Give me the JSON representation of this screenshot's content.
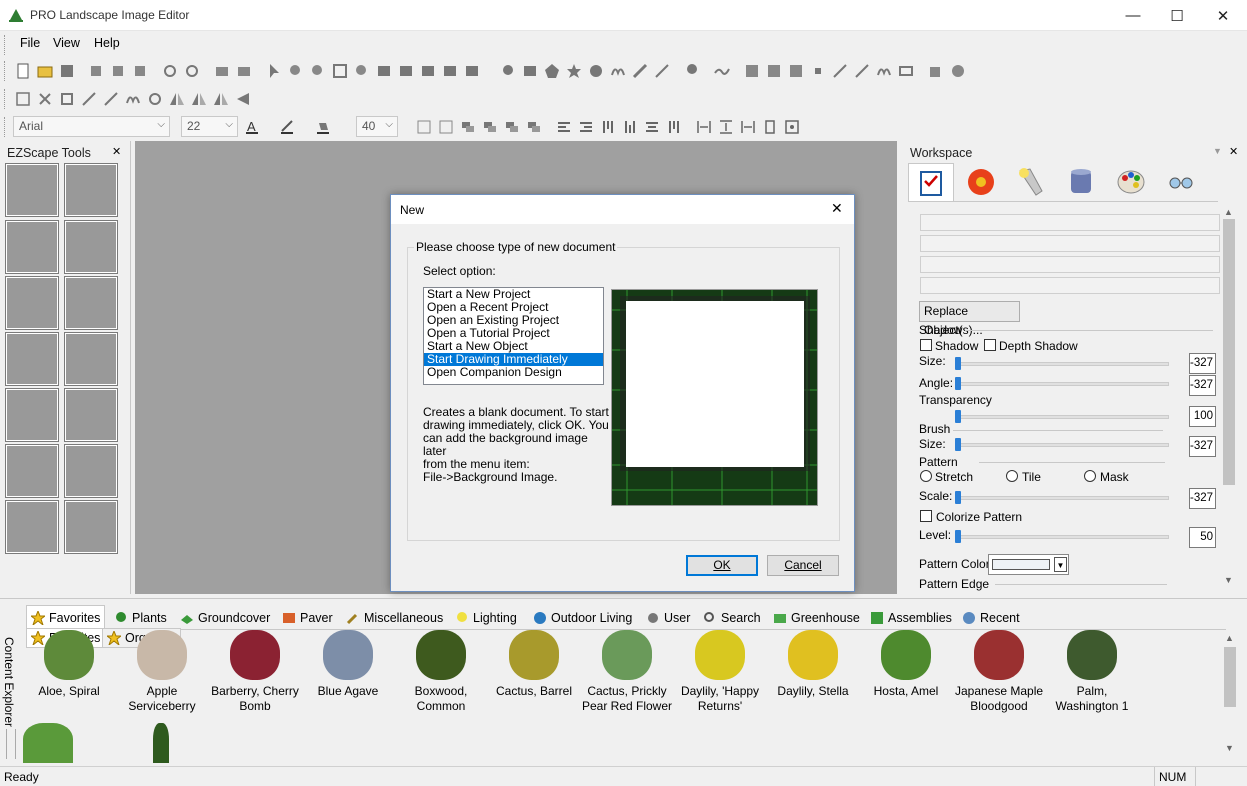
{
  "app": {
    "title": "PRO Landscape Image Editor"
  },
  "window_controls": {
    "minimize": "—",
    "maximize": "☐",
    "close": "✕"
  },
  "menu": [
    "File",
    "View",
    "Help"
  ],
  "toolbar": {
    "font_name": "Arial",
    "font_size": "22",
    "line_width": "40"
  },
  "left_panel": {
    "title": "EZScape Tools",
    "close": "✕"
  },
  "workspace": {
    "title": "Workspace",
    "close": "✕",
    "tabs": [
      "checklist-icon",
      "flower-icon",
      "flashlight-icon",
      "database-icon",
      "palette-icon",
      "glasses-icon"
    ],
    "replace_button": "Replace Object(s)...",
    "shadow_heading": "Shadow",
    "shadow_label": "Shadow",
    "depth_shadow_label": "Depth Shadow",
    "size_label": "Size:",
    "size_value": "-327",
    "angle_label": "Angle:",
    "angle_value": "-327",
    "transparency_heading": "Transparency",
    "transparency_value": "100",
    "brush_heading": "Brush",
    "brush_size_label": "Size:",
    "brush_size_value": "-327",
    "pattern_heading": "Pattern",
    "stretch_label": "Stretch",
    "tile_label": "Tile",
    "mask_label": "Mask",
    "scale_label": "Scale:",
    "scale_value": "-327",
    "colorize_label": "Colorize Pattern",
    "level_label": "Level:",
    "level_value": "50",
    "pattern_color_label": "Pattern Color:",
    "pattern_edge_label": "Pattern Edge"
  },
  "dialog": {
    "title": "New",
    "group_label": "Please choose type of new document",
    "select_label": "Select option:",
    "options": [
      "Start a New Project",
      "Open a Recent Project",
      "Open an Existing Project",
      "Open a Tutorial Project",
      "Start a New Object",
      "Start Drawing Immediately",
      "Open Companion Design"
    ],
    "selected_index": 5,
    "description": [
      "Creates a blank document. To start",
      "drawing immediately, click OK.  You",
      "can add the background image later",
      "from the menu item:",
      "File->Background Image."
    ],
    "ok": "OK",
    "cancel": "Cancel"
  },
  "content_explorer": {
    "side_label": "Content Explorer",
    "tabs": [
      "Favorites",
      "Plants",
      "Groundcover",
      "Paver",
      "Miscellaneous",
      "Lighting",
      "Outdoor Living",
      "User",
      "Search",
      "Greenhouse",
      "Assemblies",
      "Recent"
    ],
    "subtabs": [
      "Favorites",
      "Organize"
    ],
    "items": [
      {
        "name": "Aloe, Spiral",
        "color": "#5e8a3a"
      },
      {
        "name": "Apple Serviceberry",
        "color": "#c8b8a8"
      },
      {
        "name": "Barberry, Cherry Bomb",
        "color": "#8b2232"
      },
      {
        "name": "Blue Agave",
        "color": "#7d8ea8"
      },
      {
        "name": "Boxwood, Common",
        "color": "#3e5a1e"
      },
      {
        "name": "Cactus, Barrel",
        "color": "#a89a2c"
      },
      {
        "name": "Cactus, Prickly Pear Red Flower",
        "color": "#6a9a5a"
      },
      {
        "name": "Daylily, 'Happy Returns'",
        "color": "#d8c820"
      },
      {
        "name": "Daylily, Stella",
        "color": "#e0c020"
      },
      {
        "name": "Hosta, Amel",
        "color": "#4e8a2e"
      },
      {
        "name": "Japanese Maple Bloodgood",
        "color": "#9a3030"
      },
      {
        "name": "Palm, Washington 1",
        "color": "#3e5a2e"
      }
    ]
  },
  "status": {
    "left": "Ready",
    "num": "NUM"
  }
}
